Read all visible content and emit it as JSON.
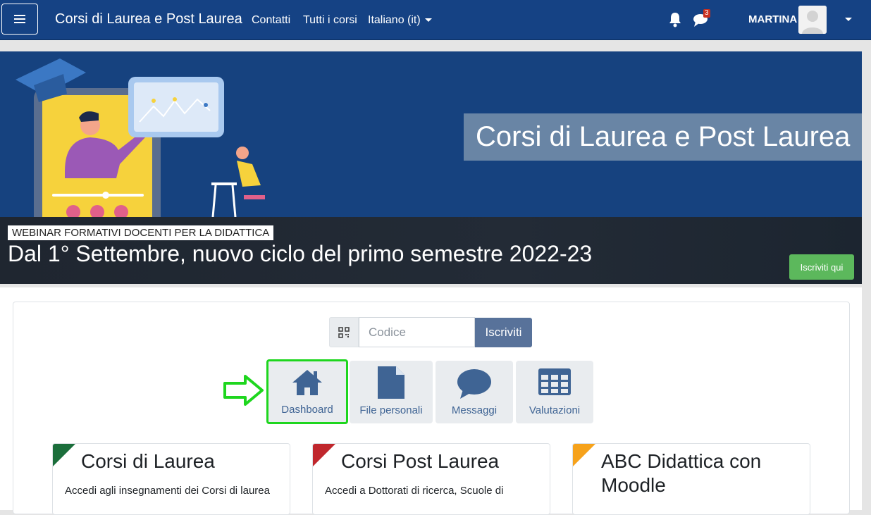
{
  "navbar": {
    "brand": "Corsi di Laurea e Post Laurea",
    "links": [
      "Contatti",
      "Tutti i corsi"
    ],
    "language": "Italiano (it)",
    "messages_badge": "3",
    "username": "MARTINA"
  },
  "hero": {
    "title": "Corsi di Laurea e Post Laurea",
    "tag": "WEBINAR FORMATIVI DOCENTI PER LA DIDATTICA",
    "heading": "Dal 1° Settembre, nuovo ciclo del primo semestre 2022-23",
    "button": "Iscriviti qui"
  },
  "enrol": {
    "placeholder": "Codice",
    "button": "Iscriviti"
  },
  "tiles": [
    {
      "label": "Dashboard",
      "icon": "home-icon"
    },
    {
      "label": "File personali",
      "icon": "file-icon"
    },
    {
      "label": "Messaggi",
      "icon": "chat-bubble-icon"
    },
    {
      "label": "Valutazioni",
      "icon": "table-icon"
    }
  ],
  "courses": [
    {
      "title": "Corsi di Laurea",
      "desc": "Accedi agli insegnamenti dei Corsi di laurea",
      "color": "#1b6e3b"
    },
    {
      "title": "Corsi Post Laurea",
      "desc": "Accedi a Dottorati di ricerca, Scuole di",
      "color": "#c0272d"
    },
    {
      "title": "ABC Didattica con Moodle",
      "desc": "",
      "color": "#f6a21b"
    }
  ],
  "colors": {
    "navbar": "#154284",
    "hero_bg": "#16427f",
    "tile_text": "#3f6494",
    "highlight": "#1ed61e",
    "enrol_button": "#5cb85c"
  }
}
